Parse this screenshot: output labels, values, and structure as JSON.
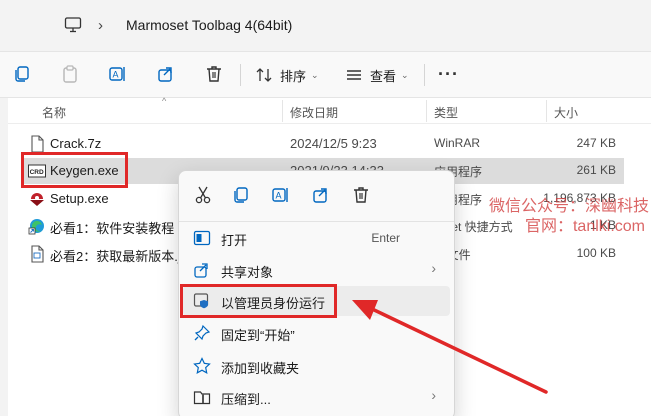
{
  "address": {
    "path": "Marmoset Toolbag 4(64bit)"
  },
  "toolbar": {
    "sort_label": "排序",
    "view_label": "查看"
  },
  "columns": {
    "name": "名称",
    "date": "修改日期",
    "type": "类型",
    "size": "大小"
  },
  "files": [
    {
      "name": "Crack.7z",
      "date": "2024/12/5 9:23",
      "type": "WinRAR",
      "size": "247 KB"
    },
    {
      "name": "Keygen.exe",
      "date": "2021/9/23 14:33",
      "type": "应用程序",
      "size": "261 KB"
    },
    {
      "name": "Setup.exe",
      "date": "",
      "type": "应用程序",
      "size": "1,196,873 KB"
    },
    {
      "name": "必看1：软件安装教程（",
      "date": "",
      "type": "ernet 快捷方式",
      "size": "1 KB"
    },
    {
      "name": "必看2：获取最新版本.jp",
      "date": "",
      "type": "G 文件",
      "size": "100 KB"
    }
  ],
  "watermark": {
    "line1": "微信公众号：深幽科技",
    "line2": "官网：tanlki.com"
  },
  "context_menu": {
    "open": "打开",
    "open_shortcut": "Enter",
    "share": "共享对象",
    "run_as_admin": "以管理员身份运行",
    "pin_start": "固定到“开始”",
    "add_favorite": "添加到收藏夹",
    "compress": "压缩到..."
  },
  "colors": {
    "highlight": "#e02828",
    "accent": "#0067c0"
  }
}
